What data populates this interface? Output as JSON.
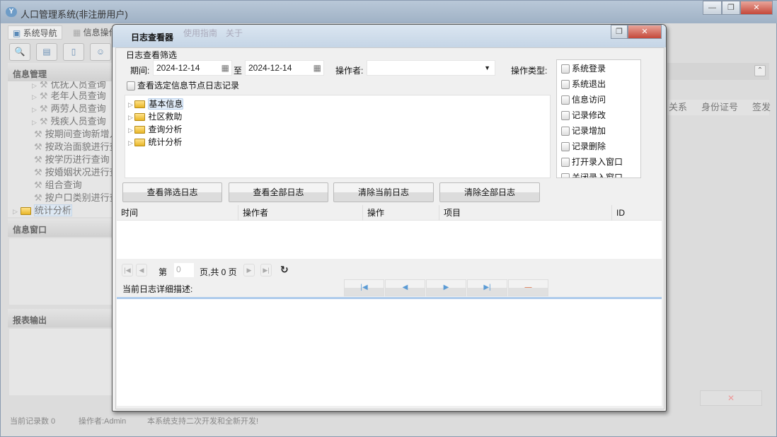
{
  "app": {
    "title": "人口管理系统(非注册用户)",
    "logo": "Y"
  },
  "window_controls": {
    "minimize": "—",
    "restore": "❐",
    "close": "✕"
  },
  "nav_tabs": [
    "系统导航",
    "信息操作"
  ],
  "bg_menu": [
    "使用指南",
    "关于"
  ],
  "toolbar_icons": [
    "search-icon",
    "list-icon",
    "document-icon",
    "user-card-icon"
  ],
  "sidebar": {
    "info_mgmt": "信息管理",
    "items": [
      "优抚人员查询",
      "老年人员查询",
      "两劳人员查询",
      "残疾人员查询",
      "按期间查询新增人员",
      "按政治面貌进行查询",
      "按学历进行查询",
      "按婚姻状况进行查询",
      "组合查询",
      "按户口类别进行查询"
    ],
    "folder": "统计分析",
    "info_window": "信息窗口",
    "report": "报表输出"
  },
  "bg_table_headers": [
    "关系",
    "身份证号",
    "签发"
  ],
  "status": {
    "records": "当前记录数 0",
    "operator": "操作者:Admin",
    "note": "本系统支持二次开发和全新开发!"
  },
  "dialog": {
    "title": "日志查看器",
    "filter_title": "日志查看筛选",
    "period_label": "期间:",
    "date_from": "2024-12-14",
    "to_label": "至",
    "date_to": "2024-12-14",
    "operator_label": "操作者:",
    "operator_value": "",
    "optype_label": "操作类型:",
    "node_checkbox": "查看选定信息节点日志记录",
    "tree": [
      "基本信息",
      "社区救助",
      "查询分析",
      "统计分析"
    ],
    "op_types": [
      "系统登录",
      "系统退出",
      "信息访问",
      "记录修改",
      "记录增加",
      "记录删除",
      "打开录入窗口",
      "关闭录入窗口"
    ],
    "buttons": [
      "查看筛选日志",
      "查看全部日志",
      "清除当前日志",
      "清除全部日志"
    ],
    "columns": [
      "时间",
      "操作者",
      "操作",
      "项目",
      "ID"
    ],
    "pager": {
      "page_prefix": "第",
      "page_value": "0",
      "page_suffix": "页,共 0 页"
    },
    "detail_label": "当前日志详细描述:",
    "detail_text": ""
  }
}
